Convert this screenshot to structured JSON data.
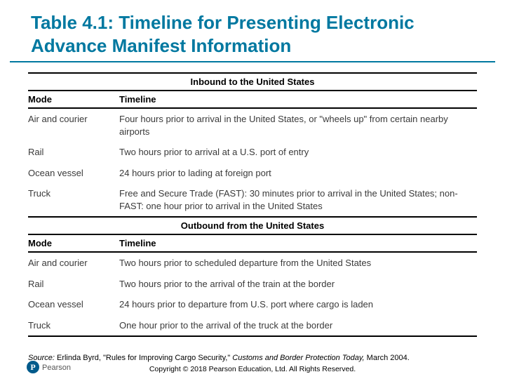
{
  "title": "Table 4.1: Timeline for Presenting Electronic Advance Manifest Information",
  "sections": [
    {
      "heading": "Inbound to the United States",
      "col1": "Mode",
      "col2": "Timeline",
      "rows": [
        {
          "mode": "Air and courier",
          "timeline": "Four hours prior to arrival in the United States, or \"wheels up\" from certain nearby airports"
        },
        {
          "mode": "Rail",
          "timeline": "Two hours prior to arrival at a U.S. port of entry"
        },
        {
          "mode": "Ocean vessel",
          "timeline": "24 hours prior to lading at foreign port"
        },
        {
          "mode": "Truck",
          "timeline": "Free and Secure Trade (FAST): 30 minutes prior to arrival in the United States; non-FAST: one hour prior to arrival in the United States"
        }
      ]
    },
    {
      "heading": "Outbound from the United States",
      "col1": "Mode",
      "col2": "Timeline",
      "rows": [
        {
          "mode": "Air and courier",
          "timeline": "Two hours prior to scheduled departure from the United States"
        },
        {
          "mode": "Rail",
          "timeline": "Two hours prior to the arrival of the train at the border"
        },
        {
          "mode": "Ocean vessel",
          "timeline": "24 hours prior to departure from U.S. port where cargo is laden"
        },
        {
          "mode": "Truck",
          "timeline": "One hour prior to the arrival of the truck at the border"
        }
      ]
    }
  ],
  "source": {
    "label": "Source:",
    "text": " Erlinda Byrd, \"Rules for Improving Cargo Security,\" ",
    "publication": "Customs and Border Protection Today,",
    "tail": " March 2004."
  },
  "footer": "Copyright © 2018 Pearson Education, Ltd. All Rights Reserved.",
  "publisher": "Pearson",
  "logo_letter": "P"
}
